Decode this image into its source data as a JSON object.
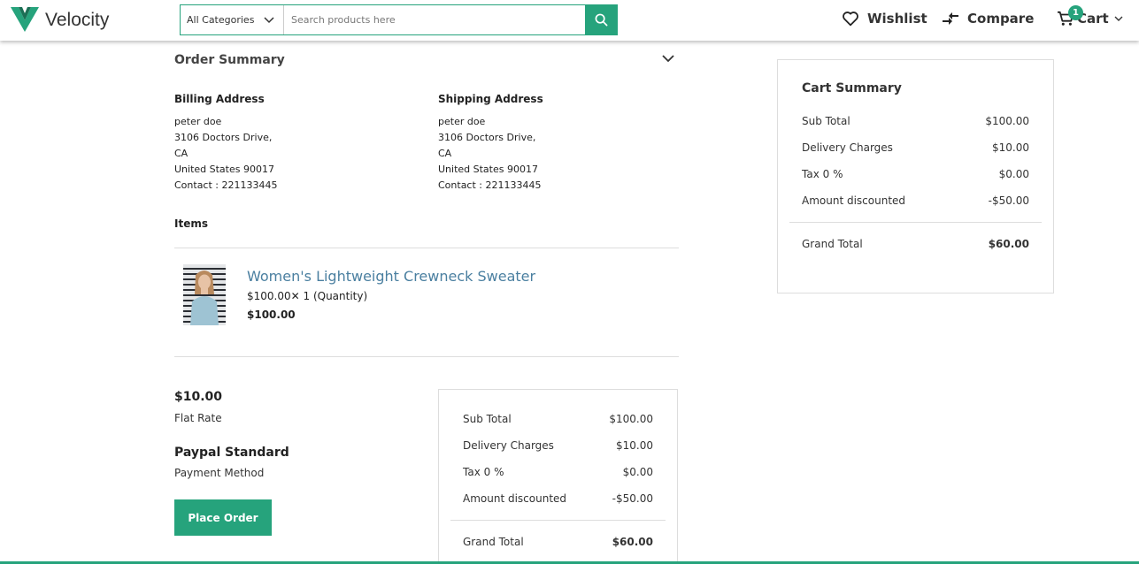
{
  "header": {
    "logo_text": "Velocity",
    "category_select": "All Categories",
    "search_placeholder": "Search products here",
    "wishlist_label": "Wishlist",
    "compare_label": "Compare",
    "cart_label": "Cart",
    "cart_count": "1",
    "accent_color": "#26a37c"
  },
  "order": {
    "title": "Order Summary",
    "billing": {
      "title": "Billing Address",
      "name": "peter doe",
      "street": "3106 Doctors Drive,",
      "state": "CA",
      "country_zip": "United States 90017",
      "contact": "Contact : 221133445"
    },
    "shipping": {
      "title": "Shipping Address",
      "name": "peter doe",
      "street": "3106 Doctors Drive,",
      "state": "CA",
      "country_zip": "United States 90017",
      "contact": "Contact : 221133445"
    },
    "items_label": "Items",
    "item": {
      "name": "Women's Lightweight Crewneck Sweater",
      "qty_line": "$100.00✕ 1 (Quantity)",
      "total": "$100.00"
    },
    "shipping_method": {
      "price": "$10.00",
      "name": "Flat Rate"
    },
    "payment": {
      "name": "Paypal Standard",
      "label": "Payment Method"
    },
    "place_order_label": "Place Order"
  },
  "inline_summary": {
    "rows": [
      {
        "label": "Sub Total",
        "value": "$100.00"
      },
      {
        "label": "Delivery Charges",
        "value": "$10.00"
      },
      {
        "label": "Tax 0 %",
        "value": "$0.00"
      },
      {
        "label": "Amount discounted",
        "value": "-$50.00"
      }
    ],
    "grand_label": "Grand Total",
    "grand_value": "$60.00"
  },
  "cart_summary": {
    "title": "Cart Summary",
    "rows": [
      {
        "label": "Sub Total",
        "value": "$100.00"
      },
      {
        "label": "Delivery Charges",
        "value": "$10.00"
      },
      {
        "label": "Tax 0 %",
        "value": "$0.00"
      },
      {
        "label": "Amount discounted",
        "value": "-$50.00"
      }
    ],
    "grand_label": "Grand Total",
    "grand_value": "$60.00"
  }
}
